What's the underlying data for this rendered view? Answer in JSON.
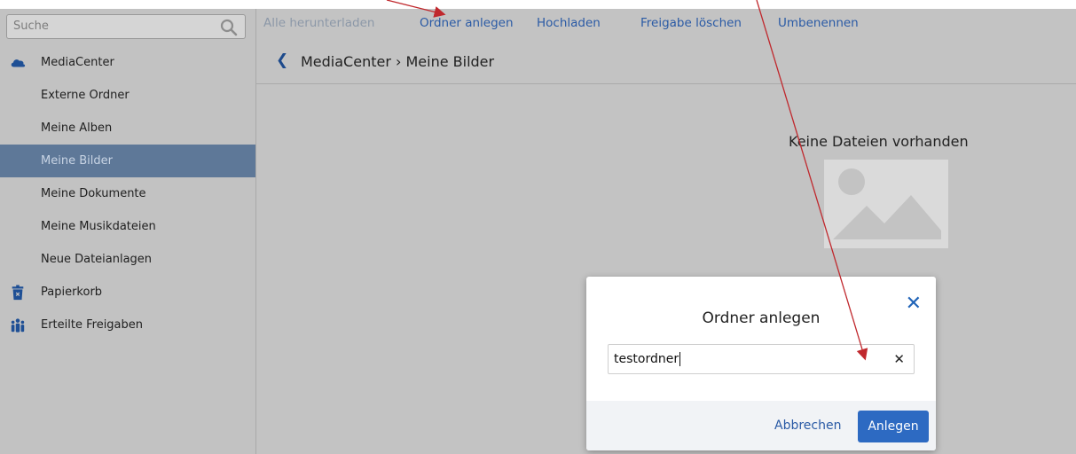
{
  "sidebar": {
    "search": {
      "placeholder": "Suche",
      "icon": "search-icon"
    },
    "items": [
      {
        "label": "MediaCenter",
        "icon": "cloud-icon",
        "active": false
      },
      {
        "label": "Externe Ordner",
        "active": false
      },
      {
        "label": "Meine Alben",
        "active": false
      },
      {
        "label": "Meine Bilder",
        "active": true
      },
      {
        "label": "Meine Dokumente",
        "active": false
      },
      {
        "label": "Meine Musikdateien",
        "active": false
      },
      {
        "label": "Neue Dateianlagen",
        "active": false
      },
      {
        "label": "Papierkorb",
        "icon": "trash-icon",
        "active": false
      },
      {
        "label": "Erteilte Freigaben",
        "icon": "people-icon",
        "active": false
      }
    ]
  },
  "toolbar": {
    "download_all": "Alle herunterladen",
    "create_folder": "Ordner anlegen",
    "upload": "Hochladen",
    "delete_share": "Freigabe löschen",
    "rename": "Umbenennen"
  },
  "breadcrumb": {
    "back_icon": "chevron-left-icon",
    "path": "MediaCenter › Meine Bilder"
  },
  "main": {
    "empty_text": "Keine Dateien vorhanden",
    "empty_icon": "image-placeholder-icon"
  },
  "dialog": {
    "title": "Ordner anlegen",
    "input_value": "testordner",
    "cancel_label": "Abbrechen",
    "confirm_label": "Anlegen",
    "close_icon": "close-icon",
    "clear_icon": "clear-icon"
  },
  "colors": {
    "accent": "#2d6ac2",
    "annotation_arrow": "#c0282d",
    "active_item": "#5e7898"
  }
}
